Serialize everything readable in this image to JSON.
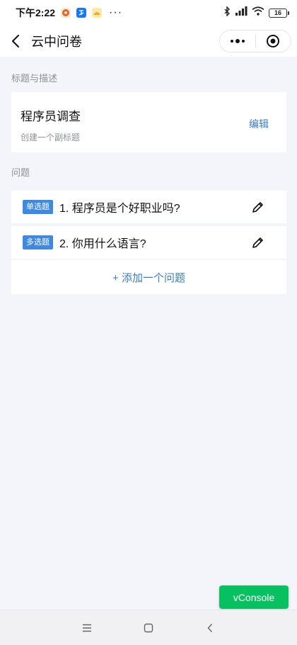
{
  "status_bar": {
    "time": "下午2:22",
    "app_icons": [
      "pinduoduo-icon",
      "alipay-icon",
      "taobao-icon"
    ],
    "more_dots": "···",
    "battery_level": "16"
  },
  "nav": {
    "title": "云中问卷"
  },
  "title_section": {
    "label": "标题与描述",
    "survey_title": "程序员调查",
    "subtitle_placeholder": "创建一个副标题",
    "edit_label": "编辑"
  },
  "questions_section": {
    "label": "问题",
    "questions": [
      {
        "tag": "单选题",
        "text": "1. 程序员是个好职业吗?"
      },
      {
        "tag": "多选题",
        "text": "2. 你用什么语言?"
      }
    ],
    "add_label": "+ 添加一个问题"
  },
  "vconsole": {
    "label": "vConsole"
  },
  "colors": {
    "accent": "#3b7cc4",
    "tag_bg": "#3f8ae0",
    "vconsole_green": "#07c160",
    "page_bg": "#f3f5fa"
  }
}
